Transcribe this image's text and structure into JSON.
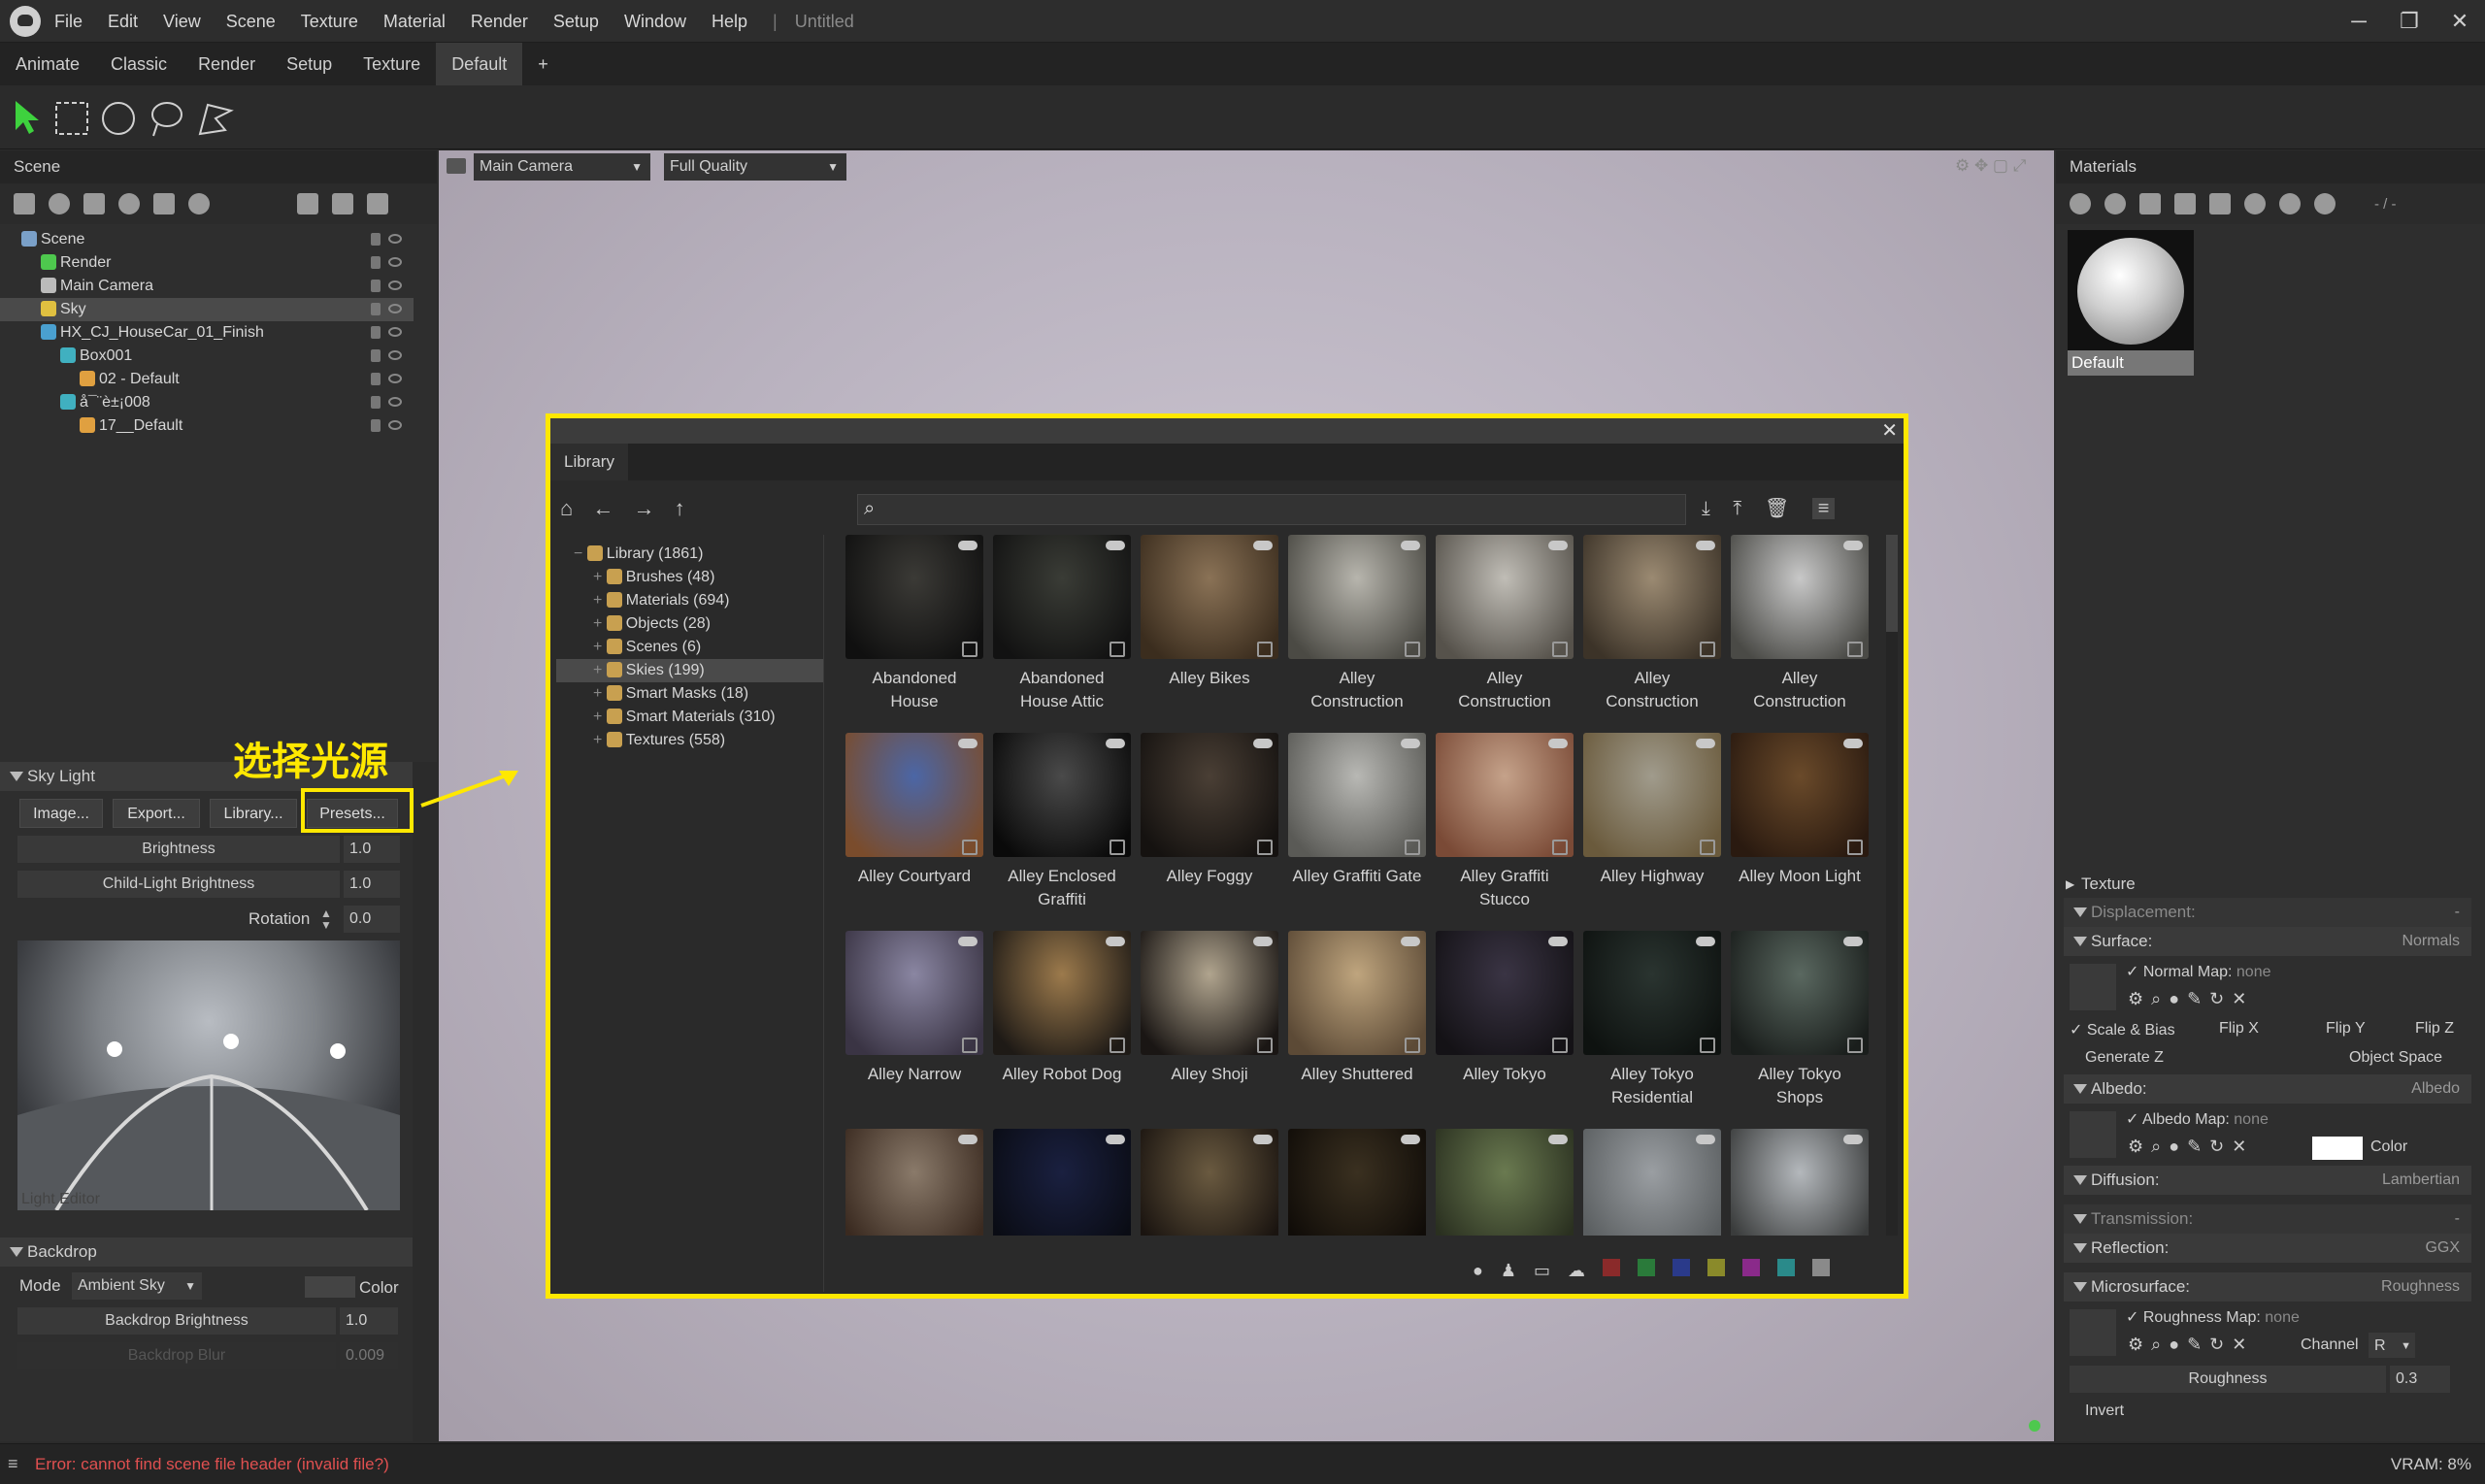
{
  "menubar": {
    "items": [
      "File",
      "Edit",
      "View",
      "Scene",
      "Texture",
      "Material",
      "Render",
      "Setup",
      "Window",
      "Help"
    ],
    "separator": "|",
    "document_title": "Untitled"
  },
  "window_controls": [
    "─",
    "❐",
    "✕"
  ],
  "tabs": [
    "Animate",
    "Classic",
    "Render",
    "Setup",
    "Texture",
    "Default",
    "+"
  ],
  "active_tab": "Default",
  "scene_panel": {
    "title": "Scene",
    "tree": [
      {
        "label": "Scene",
        "indent": 0
      },
      {
        "label": "Render",
        "indent": 1
      },
      {
        "label": "Main Camera",
        "indent": 1
      },
      {
        "label": "Sky",
        "indent": 1,
        "selected": true
      },
      {
        "label": "HX_CJ_HouseCar_01_Finish",
        "indent": 1
      },
      {
        "label": "Box001",
        "indent": 2
      },
      {
        "label": "02 - Default",
        "indent": 3
      },
      {
        "label": "å¯¨è±¡008",
        "indent": 2
      },
      {
        "label": "17__Default",
        "indent": 3
      }
    ]
  },
  "sky_light": {
    "title": "Sky Light",
    "buttons": [
      "Image...",
      "Export...",
      "Library...",
      "Presets..."
    ],
    "brightness_label": "Brightness",
    "brightness_value": "1.0",
    "child_light_label": "Child-Light Brightness",
    "child_light_value": "1.0",
    "rotation_label": "Rotation",
    "rotation_value": "0.0",
    "light_editor_label": "Light Editor"
  },
  "annotation": {
    "text": "选择光源",
    "color": "#ffe800"
  },
  "backdrop": {
    "title": "Backdrop",
    "mode_label": "Mode",
    "mode_value": "Ambient Sky",
    "color_label": "Color",
    "brightness_label": "Backdrop Brightness",
    "brightness_value": "1.0",
    "blur_label": "Backdrop Blur",
    "blur_value": "0.009"
  },
  "viewport": {
    "camera": "Main Camera",
    "quality": "Full Quality"
  },
  "library": {
    "tab": "Library",
    "search_placeholder": "",
    "tree": [
      {
        "label": "Library (1861)",
        "indent": 0
      },
      {
        "label": "Brushes (48)",
        "indent": 1
      },
      {
        "label": "Materials (694)",
        "indent": 1
      },
      {
        "label": "Objects (28)",
        "indent": 1
      },
      {
        "label": "Scenes (6)",
        "indent": 1
      },
      {
        "label": "Skies (199)",
        "indent": 1,
        "selected": true
      },
      {
        "label": "Smart Masks (18)",
        "indent": 1
      },
      {
        "label": "Smart Materials (310)",
        "indent": 1
      },
      {
        "label": "Textures (558)",
        "indent": 1
      }
    ],
    "items": [
      {
        "label": "Abandoned\nHouse",
        "c1": "#3b3a36",
        "c2": "#101010"
      },
      {
        "label": "Abandoned\nHouse Attic",
        "c1": "#3a3c36",
        "c2": "#121212"
      },
      {
        "label": "Alley Bikes",
        "c1": "#8a7256",
        "c2": "#3b2d1e"
      },
      {
        "label": "Alley\nConstruction",
        "c1": "#b7b5ad",
        "c2": "#4b4a44"
      },
      {
        "label": "Alley\nConstruction",
        "c1": "#c0bdb6",
        "c2": "#56524b"
      },
      {
        "label": "Alley\nConstruction",
        "c1": "#9b8a72",
        "c2": "#3c3328"
      },
      {
        "label": "Alley\nConstruction",
        "c1": "#c8c8c8",
        "c2": "#4a4a46"
      },
      {
        "label": "Alley Courtyard",
        "c1": "#4b66a6",
        "c2": "#7a4c2c"
      },
      {
        "label": "Alley Enclosed\nGraffiti",
        "c1": "#4a4a4a",
        "c2": "#0a0a0a"
      },
      {
        "label": "Alley Foggy",
        "c1": "#4a3f35",
        "c2": "#151210"
      },
      {
        "label": "Alley Graffiti Gate",
        "c1": "#b8b8b4",
        "c2": "#5a5a56"
      },
      {
        "label": "Alley Graffiti\nStucco",
        "c1": "#c5a28a",
        "c2": "#7a4a36"
      },
      {
        "label": "Alley Highway",
        "c1": "#a09b8c",
        "c2": "#6a5a3c"
      },
      {
        "label": "Alley Moon Light",
        "c1": "#6a4a2a",
        "c2": "#2a1a10"
      },
      {
        "label": "Alley Narrow",
        "c1": "#8a86a2",
        "c2": "#3a3444"
      },
      {
        "label": "Alley Robot Dog",
        "c1": "#9c7a4c",
        "c2": "#1e1a16"
      },
      {
        "label": "Alley Shoji",
        "c1": "#b0a48e",
        "c2": "#1a1614"
      },
      {
        "label": "Alley Shuttered",
        "c1": "#bfa57e",
        "c2": "#5c4a36"
      },
      {
        "label": "Alley Tokyo",
        "c1": "#3a3444",
        "c2": "#141216"
      },
      {
        "label": "Alley Tokyo\nResidential",
        "c1": "#2a3430",
        "c2": "#0e1210"
      },
      {
        "label": "Alley Tokyo\nShops",
        "c1": "#5a6860",
        "c2": "#1a1e1c"
      },
      {
        "label": "",
        "c1": "#8a7a6a",
        "c2": "#3a2a20"
      },
      {
        "label": "",
        "c1": "#1a2040",
        "c2": "#0a0c14"
      },
      {
        "label": "",
        "c1": "#6a5a40",
        "c2": "#1a1410"
      },
      {
        "label": "",
        "c1": "#3a3020",
        "c2": "#100c08"
      },
      {
        "label": "",
        "c1": "#6a7a50",
        "c2": "#2a3020"
      },
      {
        "label": "",
        "c1": "#9a9ea2",
        "c2": "#5a5e60"
      },
      {
        "label": "",
        "c1": "#b4b8bc",
        "c2": "#3a3c3c"
      }
    ],
    "footer_colors": [
      "#8a2a2a",
      "#2a7a3a",
      "#2a3a8a",
      "#8a8a2a",
      "#8a2a8a",
      "#2a8a8a",
      "#8a8a8a"
    ]
  },
  "materials": {
    "title": "Materials",
    "counter": "- / -",
    "preview_label": "Default",
    "texture_label": "Texture",
    "displacement_label": "Displacement:",
    "displacement_value": "-",
    "surface_label": "Surface:",
    "surface_value": "Normals",
    "normal_map_label": "Normal Map:",
    "normal_map_value": "none",
    "scale_bias": "Scale & Bias",
    "flip_x": "Flip X",
    "flip_y": "Flip Y",
    "flip_z": "Flip Z",
    "generate_z": "Generate Z",
    "object_space": "Object Space",
    "albedo_label": "Albedo:",
    "albedo_value": "Albedo",
    "albedo_map_label": "Albedo Map:",
    "albedo_map_value": "none",
    "color_label": "Color",
    "diffusion_label": "Diffusion:",
    "diffusion_value": "Lambertian",
    "transmission_label": "Transmission:",
    "transmission_value": "-",
    "reflection_label": "Reflection:",
    "reflection_value": "GGX",
    "microsurface_label": "Microsurface:",
    "microsurface_value": "Roughness",
    "roughness_map_label": "Roughness Map:",
    "roughness_map_value": "none",
    "channel_label": "Channel",
    "channel_value": "R",
    "roughness_label": "Roughness",
    "roughness_value": "0.3",
    "invert_label": "Invert"
  },
  "statusbar": {
    "error": "Error: cannot find scene file header (invalid file?)",
    "vram": "VRAM: 8%"
  }
}
